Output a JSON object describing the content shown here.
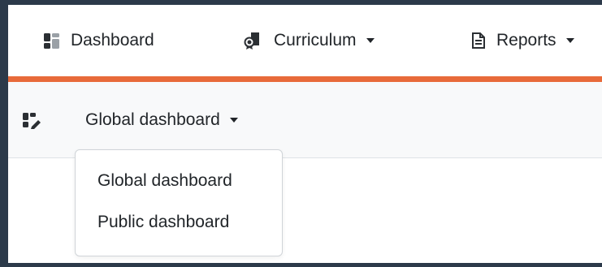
{
  "topnav": {
    "items": [
      {
        "label": "Dashboard",
        "icon": "dashboard-icon",
        "dropdown": false
      },
      {
        "label": "Curriculum",
        "icon": "curriculum-icon",
        "dropdown": true
      },
      {
        "label": "Reports",
        "icon": "report-icon",
        "dropdown": true
      }
    ]
  },
  "accent_color": "#e86a3a",
  "subnav": {
    "icon": "dashboard-edit-icon",
    "toggle_label": "Global dashboard"
  },
  "dropdown": {
    "options": [
      "Global dashboard",
      "Public dashboard"
    ]
  }
}
